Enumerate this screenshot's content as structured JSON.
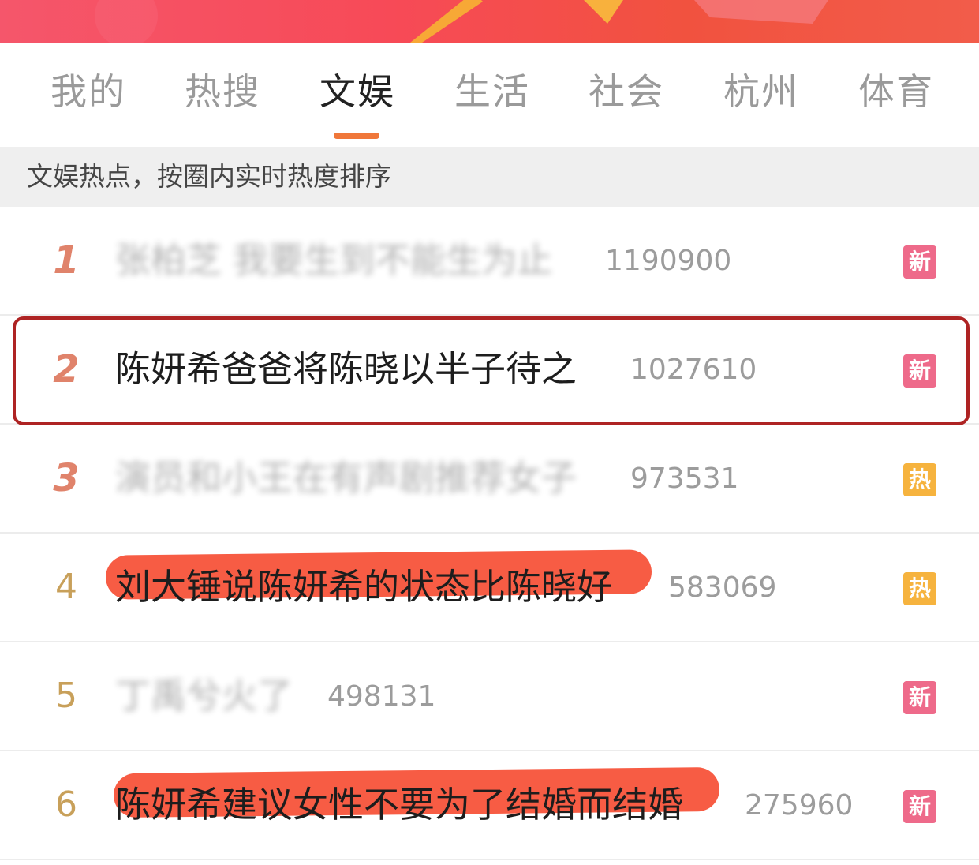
{
  "tabs": [
    {
      "label": "我的"
    },
    {
      "label": "热搜"
    },
    {
      "label": "文娱"
    },
    {
      "label": "生活"
    },
    {
      "label": "社会"
    },
    {
      "label": "杭州"
    },
    {
      "label": "体育"
    }
  ],
  "active_tab": "文娱",
  "subheader": "文娱热点，按圈内实时热度排序",
  "colors": {
    "accent": "#f0773a",
    "badge_new": "#ee6a8a",
    "badge_hot": "#f6b33e",
    "highlight": "#f6462a",
    "annotation_box": "#ae2323"
  },
  "list": [
    {
      "rank": "1",
      "title": "张柏芝 我要生到不能生为止",
      "count": "1190900",
      "badge": "新",
      "badge_type": "new",
      "blurred": true
    },
    {
      "rank": "2",
      "title": "陈妍希爸爸将陈晓以半子待之",
      "count": "1027610",
      "badge": "新",
      "badge_type": "new",
      "blurred": false
    },
    {
      "rank": "3",
      "title": "演员和小王在有声剧推荐女子",
      "count": "973531",
      "badge": "热",
      "badge_type": "hot",
      "blurred": true
    },
    {
      "rank": "4",
      "title": "刘大锤说陈妍希的状态比陈晓好",
      "count": "583069",
      "badge": "热",
      "badge_type": "hot",
      "blurred": false
    },
    {
      "rank": "5",
      "title": "丁禹兮火了",
      "count": "498131",
      "badge": "新",
      "badge_type": "new",
      "blurred": true
    },
    {
      "rank": "6",
      "title": "陈妍希建议女性不要为了结婚而结婚",
      "count": "275960",
      "badge": "新",
      "badge_type": "new",
      "blurred": false
    }
  ]
}
